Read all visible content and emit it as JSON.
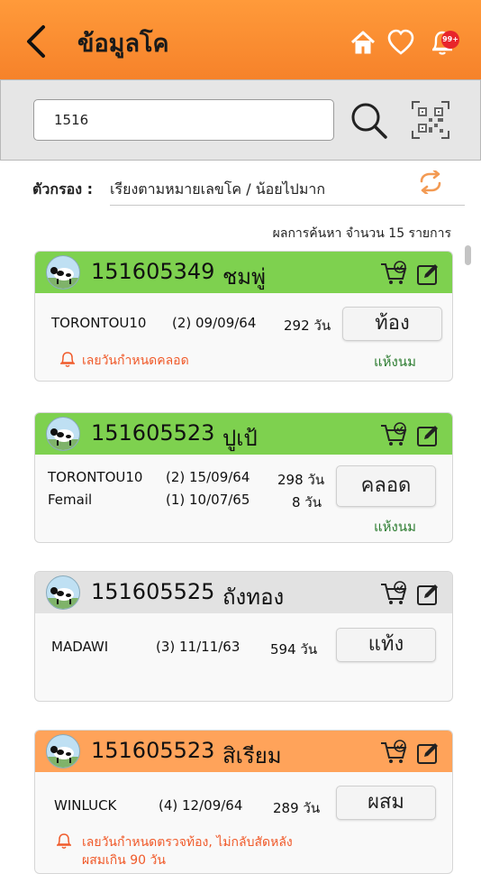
{
  "header": {
    "title": "ข้อมูลโค",
    "colors": {
      "gradient_top": "#ff9a3a",
      "gradient_bottom": "#f6822a"
    },
    "notification_badge": "99+"
  },
  "search": {
    "value": "1516",
    "placeholder": ""
  },
  "filter": {
    "label": "ตัวกรอง :",
    "value": "เรียงตามหมายเลขโค / น้อยไปมาก"
  },
  "results": {
    "summary": "ผลการค้นหา จำนวน  15  รายการ"
  },
  "cards": [
    {
      "header_color": "#7ed14f",
      "id": "151605349",
      "name": "ชมพู่",
      "line1": {
        "sire": "TORONTOU10",
        "date": "(2) 09/09/64",
        "days": "292 วัน"
      },
      "status": "ท้อง",
      "dry": "แห้งนม",
      "warning": "เลยวันกำหนดคลอด"
    },
    {
      "header_color": "#7ed14f",
      "id": "151605523",
      "name": "ปูเป้",
      "line1": {
        "sire": "TORONTOU10",
        "date": "(2) 15/09/64",
        "days": "298 วัน"
      },
      "line2": {
        "sire": "Femail",
        "date": "(1) 10/07/65",
        "days": "8 วัน"
      },
      "status": "คลอด",
      "dry": "แห้งนม"
    },
    {
      "header_color": "#e2e2e2",
      "id": "151605525",
      "name": "ถังทอง",
      "line1": {
        "sire": "MADAWI",
        "date": "(3) 11/11/63",
        "days": "594 วัน"
      },
      "status": "แท้ง"
    },
    {
      "header_color": "#ffa35a",
      "id": "151605523",
      "name": "สิเรียม",
      "line1": {
        "sire": "WINLUCK",
        "date": "(4) 12/09/64",
        "days": "289 วัน"
      },
      "status": "ผสม",
      "warning": "เลยวันกำหนดตรวจท้อง, ไม่กลับสัดหลัง",
      "warning2": "ผสมเกิน 90 วัน"
    }
  ]
}
